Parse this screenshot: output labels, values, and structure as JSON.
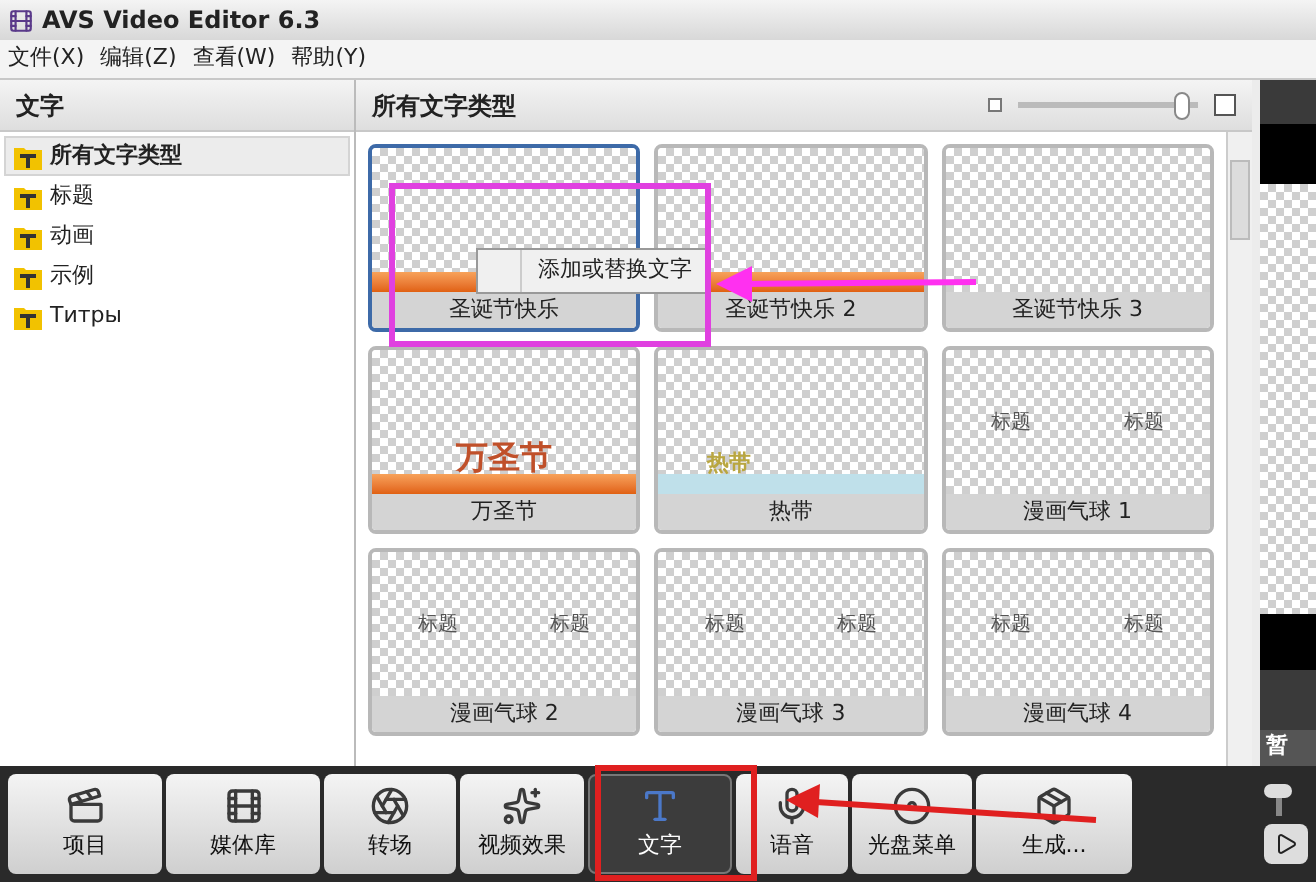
{
  "window": {
    "title": "AVS Video Editor 6.3"
  },
  "menu": [
    "文件(X)",
    "编辑(Z)",
    "查看(W)",
    "帮助(Y)"
  ],
  "sidebar": {
    "title": "文字",
    "items": [
      {
        "label": "所有文字类型",
        "selected": true
      },
      {
        "label": "标题",
        "selected": false
      },
      {
        "label": "动画",
        "selected": false
      },
      {
        "label": "示例",
        "selected": false
      },
      {
        "label": "Титры",
        "selected": false
      }
    ]
  },
  "gallery": {
    "title": "所有文字类型",
    "zoom": {
      "level": 0.95
    },
    "cards": [
      {
        "label": "圣诞节快乐",
        "kind": "banner",
        "selected": true
      },
      {
        "label": "圣诞节快乐 2",
        "kind": "banner",
        "selected": false
      },
      {
        "label": "圣诞节快乐 3",
        "kind": "plain",
        "selected": false
      },
      {
        "label": "万圣节",
        "kind": "banner",
        "preview": [
          "万圣节"
        ],
        "selected": false
      },
      {
        "label": "热带",
        "kind": "tropical",
        "preview": [
          "热带"
        ],
        "selected": false
      },
      {
        "label": "漫画气球 1",
        "kind": "balloon",
        "preview": [
          "标题",
          "标题"
        ],
        "selected": false
      },
      {
        "label": "漫画气球 2",
        "kind": "balloon",
        "preview": [
          "标题",
          "标题"
        ],
        "selected": false
      },
      {
        "label": "漫画气球 3",
        "kind": "balloon",
        "preview": [
          "标题",
          "标题"
        ],
        "selected": false
      },
      {
        "label": "漫画气球 4",
        "kind": "balloon",
        "preview": [
          "标题",
          "标题"
        ],
        "selected": false
      }
    ]
  },
  "context_menu": {
    "items": [
      "添加或替换文字"
    ]
  },
  "preview": {
    "button": "暂"
  },
  "toolbar": [
    {
      "label": "项目",
      "selected": false
    },
    {
      "label": "媒体库",
      "selected": false
    },
    {
      "label": "转场",
      "selected": false
    },
    {
      "label": "视频效果",
      "selected": false
    },
    {
      "label": "文字",
      "selected": true
    },
    {
      "label": "语音",
      "selected": false
    },
    {
      "label": "光盘菜单",
      "selected": false
    },
    {
      "label": "生成...",
      "selected": false
    }
  ],
  "volume": {
    "level": 1
  }
}
